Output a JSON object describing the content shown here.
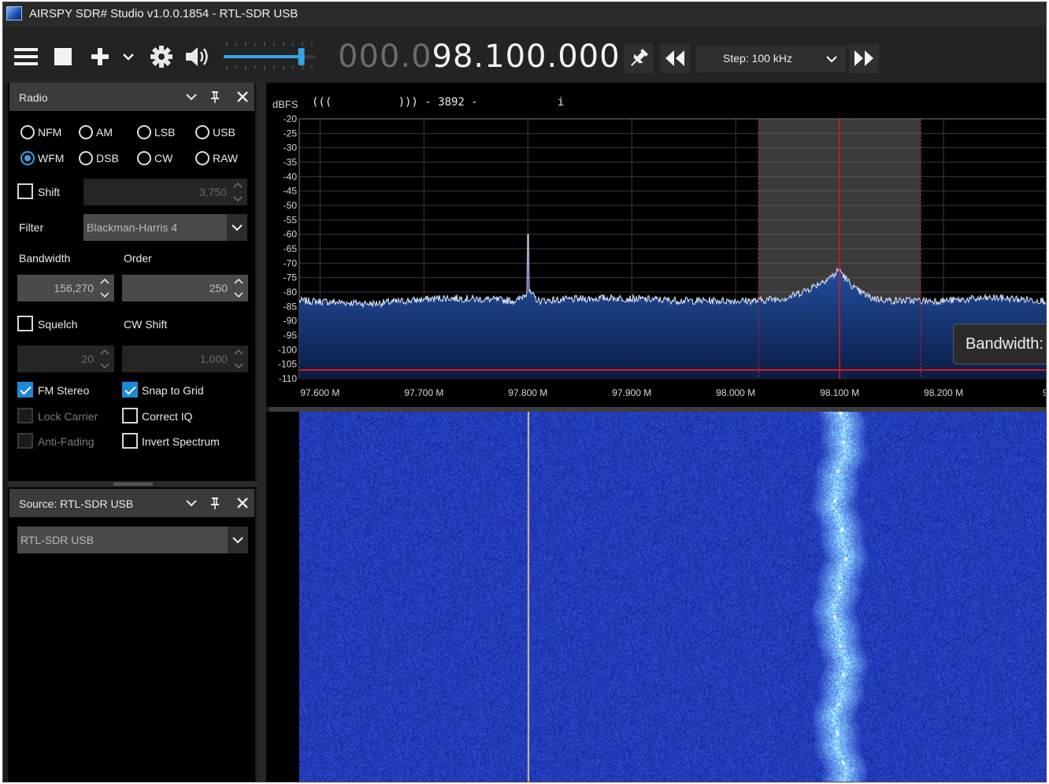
{
  "window": {
    "title": "AIRSPY SDR# Studio v1.0.0.1854 - RTL-SDR USB"
  },
  "toolbar": {
    "freq_dim": "000.0",
    "freq_bright": "98.100.000",
    "step_label": "Step: 100 kHz",
    "volume_level": 0.85
  },
  "radio_panel": {
    "title": "Radio",
    "modes": [
      {
        "label": "NFM",
        "selected": false
      },
      {
        "label": "AM",
        "selected": false
      },
      {
        "label": "LSB",
        "selected": false
      },
      {
        "label": "USB",
        "selected": false
      },
      {
        "label": "WFM",
        "selected": true
      },
      {
        "label": "DSB",
        "selected": false
      },
      {
        "label": "CW",
        "selected": false
      },
      {
        "label": "RAW",
        "selected": false
      }
    ],
    "shift_label": "Shift",
    "shift_value": "3,750",
    "filter_label": "Filter",
    "filter_value": "Blackman-Harris 4",
    "bandwidth_label": "Bandwidth",
    "bandwidth_value": "156,270",
    "order_label": "Order",
    "order_value": "250",
    "squelch_label": "Squelch",
    "squelch_value": "20",
    "cwshift_label": "CW Shift",
    "cwshift_value": "1,000",
    "fm_stereo_label": "FM Stereo",
    "snap_label": "Snap to Grid",
    "lock_carrier_label": "Lock Carrier",
    "correct_iq_label": "Correct IQ",
    "anti_fading_label": "Anti-Fading",
    "invert_label": "Invert Spectrum",
    "checks": {
      "shift": false,
      "squelch": false,
      "fm_stereo": true,
      "snap": true,
      "lock_carrier": false,
      "correct_iq": false,
      "anti_fading": false,
      "invert": false
    }
  },
  "source_panel": {
    "title": "Source: RTL-SDR USB",
    "device": "RTL-SDR USB"
  },
  "spectrum": {
    "info_line": "(((          ))) - 3892 -            i",
    "unit": "dBFS",
    "tooltip": "Bandwidth:",
    "colors": {
      "trace": "#dfe8ff",
      "fill_top": "#2a5fb8",
      "fill_bottom": "#0a1c46",
      "marker": "#e01818",
      "grid": "#3a3a3a",
      "waterfall_bg": "#1c2cb0"
    },
    "chart_data": {
      "type": "line",
      "xlabel": "",
      "ylabel": "dBFS",
      "x_ticks": [
        "97.600 M",
        "97.700 M",
        "97.800 M",
        "97.900 M",
        "98.000 M",
        "98.100 M",
        "98.200 M",
        "9"
      ],
      "y_ticks": [
        -20,
        -25,
        -30,
        -35,
        -40,
        -45,
        -50,
        -55,
        -60,
        -65,
        -70,
        -75,
        -80,
        -85,
        -90,
        -95,
        -100,
        -105,
        -110
      ],
      "ylim": [
        -110,
        -20
      ],
      "xlim_mhz": [
        97.58,
        98.3
      ],
      "squelch_level_dbfs": -107,
      "passband_mhz": [
        98.022,
        98.178
      ],
      "center_mhz": 98.1,
      "series": [
        {
          "x_mhz": [
            97.58,
            97.65,
            97.72,
            97.79,
            97.799,
            97.8,
            97.801,
            97.81,
            97.88,
            97.95,
            98.02,
            98.05,
            98.07,
            98.085,
            98.095,
            98.1,
            98.105,
            98.115,
            98.13,
            98.15,
            98.2,
            98.25,
            98.3
          ],
          "dbfs": [
            -83,
            -84,
            -82,
            -83,
            -80,
            -60,
            -80,
            -83,
            -82,
            -83,
            -83,
            -82,
            -79,
            -76,
            -74,
            -72,
            -75,
            -79,
            -82,
            -83,
            -83,
            -82,
            -83
          ]
        }
      ]
    }
  }
}
